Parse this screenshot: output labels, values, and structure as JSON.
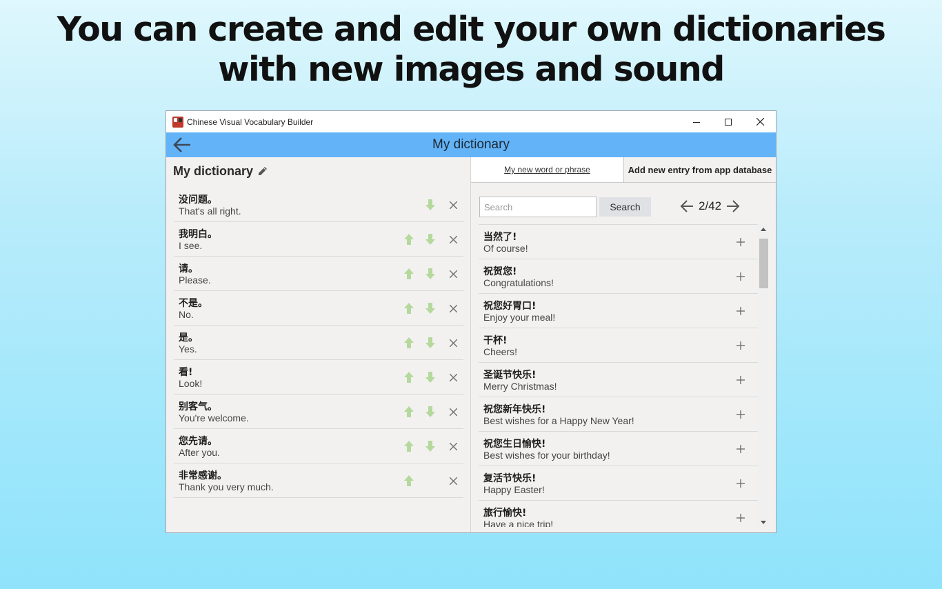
{
  "headline": {
    "line1": "You can create and edit your own dictionaries",
    "line2": "with new images and sound"
  },
  "window": {
    "title": "Chinese Visual Vocabulary Builder",
    "controls": [
      "minimize-icon",
      "maximize-icon",
      "close-icon"
    ]
  },
  "appbar": {
    "title": "My dictionary",
    "back_icon": "arrow-left-icon",
    "color": "#63b3f8"
  },
  "left": {
    "title": "My dictionary",
    "edit_icon": "pencil-icon",
    "entries": [
      {
        "zh": "没问题。",
        "en": "That's all right.",
        "up": false,
        "down": true
      },
      {
        "zh": "我明白。",
        "en": "I see.",
        "up": true,
        "down": true
      },
      {
        "zh": "请。",
        "en": "Please.",
        "up": true,
        "down": true
      },
      {
        "zh": "不是。",
        "en": "No.",
        "up": true,
        "down": true
      },
      {
        "zh": "是。",
        "en": "Yes.",
        "up": true,
        "down": true
      },
      {
        "zh": "看!",
        "en": "Look!",
        "up": true,
        "down": true
      },
      {
        "zh": "别客气。",
        "en": "You're welcome.",
        "up": true,
        "down": true
      },
      {
        "zh": "您先请。",
        "en": "After you.",
        "up": true,
        "down": true
      },
      {
        "zh": "非常感谢。",
        "en": "Thank you very much.",
        "up": true,
        "down": false
      }
    ]
  },
  "right": {
    "tab_new_word": "My new word or phrase",
    "tab_app_database": "Add new entry from app database",
    "search_placeholder": "Search",
    "search_button": "Search",
    "pager": "2/42",
    "entries": [
      {
        "zh": "当然了!",
        "en": "Of course!"
      },
      {
        "zh": "祝贺您!",
        "en": "Congratulations!"
      },
      {
        "zh": "祝您好胃口!",
        "en": "Enjoy your meal!"
      },
      {
        "zh": "干杯!",
        "en": "Cheers!"
      },
      {
        "zh": "圣诞节快乐!",
        "en": "Merry Christmas!"
      },
      {
        "zh": "祝您新年快乐!",
        "en": "Best wishes for a Happy New Year!"
      },
      {
        "zh": "祝您生日愉快!",
        "en": "Best wishes for your birthday!"
      },
      {
        "zh": "复活节快乐!",
        "en": "Happy Easter!"
      },
      {
        "zh": "旅行愉快!",
        "en": "Have a nice trip!"
      }
    ]
  },
  "colors": {
    "arrow_green": "#b5d99c",
    "icon_gray": "#6f6f6f"
  }
}
